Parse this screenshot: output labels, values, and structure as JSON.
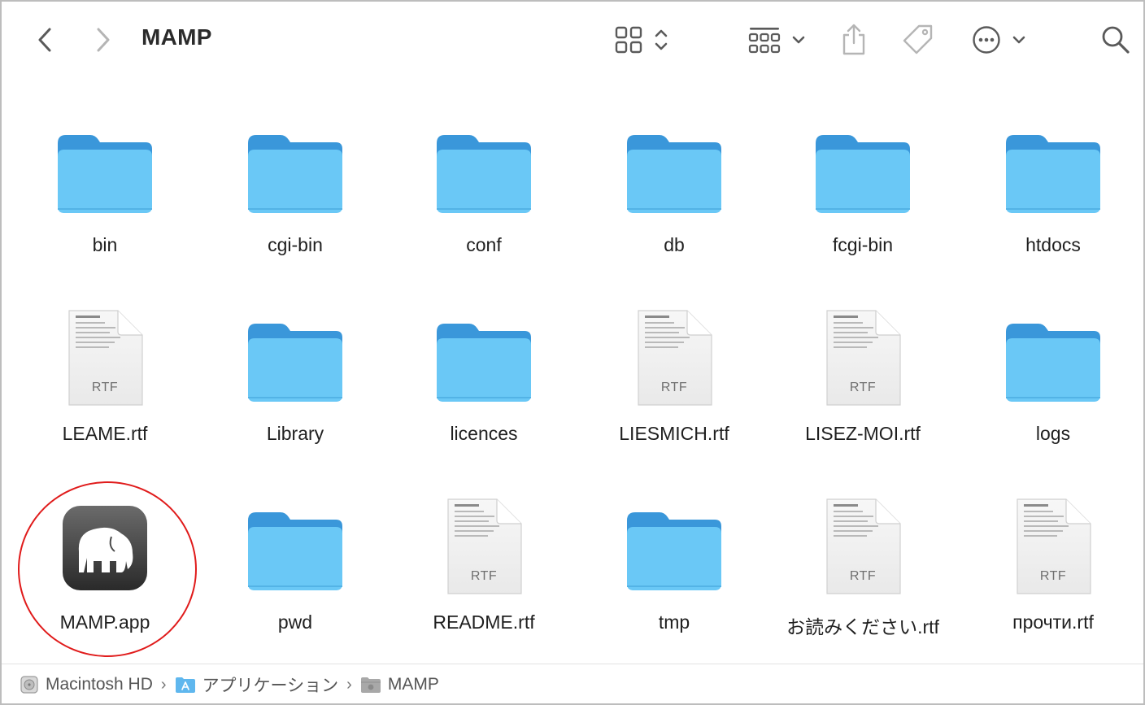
{
  "window": {
    "title": "MAMP"
  },
  "toolbar": {
    "back_icon": "chevron-left-icon",
    "forward_icon": "chevron-right-icon",
    "view_icon": "grid-view-icon",
    "group_icon": "group-icon",
    "share_icon": "share-icon",
    "tag_icon": "tag-icon",
    "more_icon": "ellipsis-circle-icon",
    "search_icon": "search-icon"
  },
  "files": [
    {
      "name": "bin",
      "kind": "folder"
    },
    {
      "name": "cgi-bin",
      "kind": "folder"
    },
    {
      "name": "conf",
      "kind": "folder"
    },
    {
      "name": "db",
      "kind": "folder"
    },
    {
      "name": "fcgi-bin",
      "kind": "folder"
    },
    {
      "name": "htdocs",
      "kind": "folder"
    },
    {
      "name": "LEAME.rtf",
      "kind": "rtf",
      "badge": "RTF"
    },
    {
      "name": "Library",
      "kind": "folder"
    },
    {
      "name": "licences",
      "kind": "folder"
    },
    {
      "name": "LIESMICH.rtf",
      "kind": "rtf",
      "badge": "RTF"
    },
    {
      "name": "LISEZ-MOI.rtf",
      "kind": "rtf",
      "badge": "RTF"
    },
    {
      "name": "logs",
      "kind": "folder"
    },
    {
      "name": "MAMP.app",
      "kind": "app"
    },
    {
      "name": "pwd",
      "kind": "folder"
    },
    {
      "name": "README.rtf",
      "kind": "rtf",
      "badge": "RTF"
    },
    {
      "name": "tmp",
      "kind": "folder"
    },
    {
      "name": "お読みください.rtf",
      "kind": "rtf",
      "badge": "RTF"
    },
    {
      "name": "прочти.rtf",
      "kind": "rtf",
      "badge": "RTF"
    }
  ],
  "pathbar": {
    "items": [
      {
        "label": "Macintosh HD",
        "icon": "hard-drive-icon"
      },
      {
        "label": "アプリケーション",
        "icon": "applications-folder-icon"
      },
      {
        "label": "MAMP",
        "icon": "folder-icon"
      }
    ],
    "separator": "›"
  },
  "colors": {
    "folder_back": "#3a97da",
    "folder_front": "#6ac8f6",
    "highlight": "#e01b1b",
    "toolbar_icon": "#5a5a5a"
  }
}
